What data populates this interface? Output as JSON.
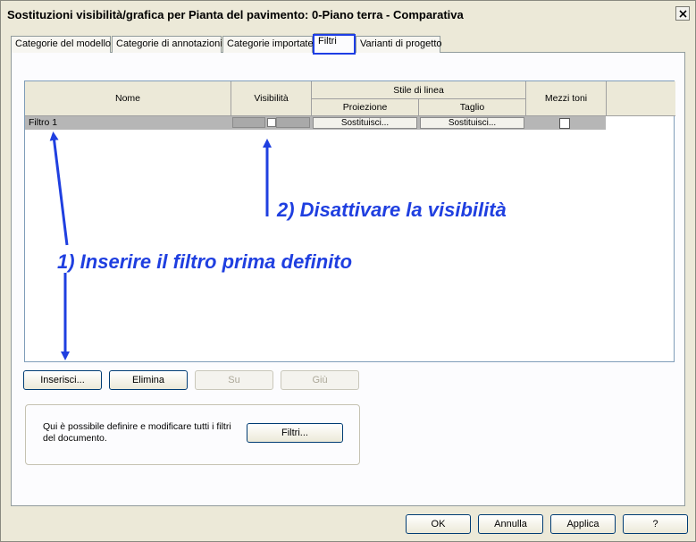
{
  "window": {
    "title": "Sostituzioni visibilità/grafica per Pianta del pavimento: 0-Piano terra - Comparativa"
  },
  "tabs": [
    {
      "label": "Categorie del modello"
    },
    {
      "label": "Categorie di annotazioni"
    },
    {
      "label": "Categorie importate"
    },
    {
      "label": "Filtri",
      "active": true
    },
    {
      "label": "Varianti di progetto"
    }
  ],
  "grid": {
    "headers": {
      "name": "Nome",
      "visibility": "Visibilità",
      "line_style": "Stile di linea",
      "projection": "Proiezione",
      "cut": "Taglio",
      "halftone": "Mezzi toni"
    },
    "rows": [
      {
        "name": "Filtro 1",
        "projection": "Sostituisci...",
        "cut": "Sostituisci...",
        "halftone": false
      }
    ]
  },
  "buttons": {
    "insert": "Inserisci...",
    "delete": "Elimina",
    "up": "Su",
    "down": "Giù"
  },
  "filters_group": {
    "text": "Qui è possibile definire e modificare tutti i filtri del documento.",
    "button": "Filtri..."
  },
  "footer": {
    "ok": "OK",
    "cancel": "Annulla",
    "apply": "Applica",
    "help": "?"
  },
  "annotations": {
    "step1": "1) Inserire il filtro prima definito",
    "step2": "2) Disattivare la visibilità",
    "color": "#1f3fe0"
  }
}
